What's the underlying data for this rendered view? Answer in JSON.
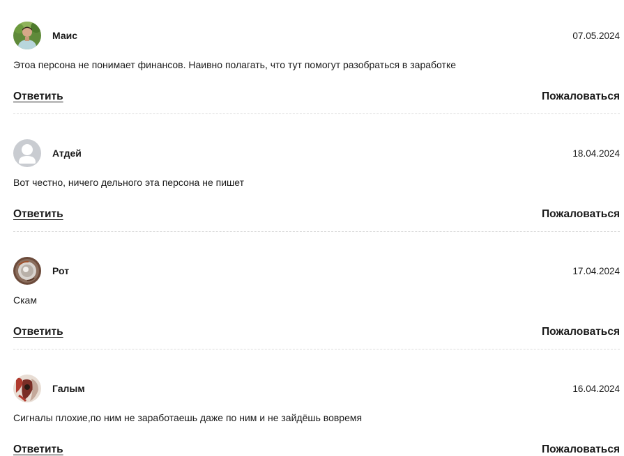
{
  "comments": [
    {
      "author": "Маис",
      "date": "07.05.2024",
      "text": "Этоа персона не понимает финансов. Наивно полагать, что тут помогут разобраться в заработке",
      "reply_label": "Ответить",
      "complain_label": "Пожаловаться",
      "avatar": "user-photo"
    },
    {
      "author": "Атдей",
      "date": "18.04.2024",
      "text": "Вот честно, ничего дельного эта персона не пишет",
      "reply_label": "Ответить",
      "complain_label": "Пожаловаться",
      "avatar": "default-avatar-icon"
    },
    {
      "author": "Рот",
      "date": "17.04.2024",
      "text": "Скам",
      "reply_label": "Ответить",
      "complain_label": "Пожаловаться",
      "avatar": "user-photo"
    },
    {
      "author": "Галым",
      "date": "16.04.2024",
      "text": "Сигналы плохие,по ним не заработаешь даже по ним и не зайдёшь вовремя",
      "reply_label": "Ответить",
      "complain_label": "Пожаловаться",
      "avatar": "user-photo"
    }
  ]
}
